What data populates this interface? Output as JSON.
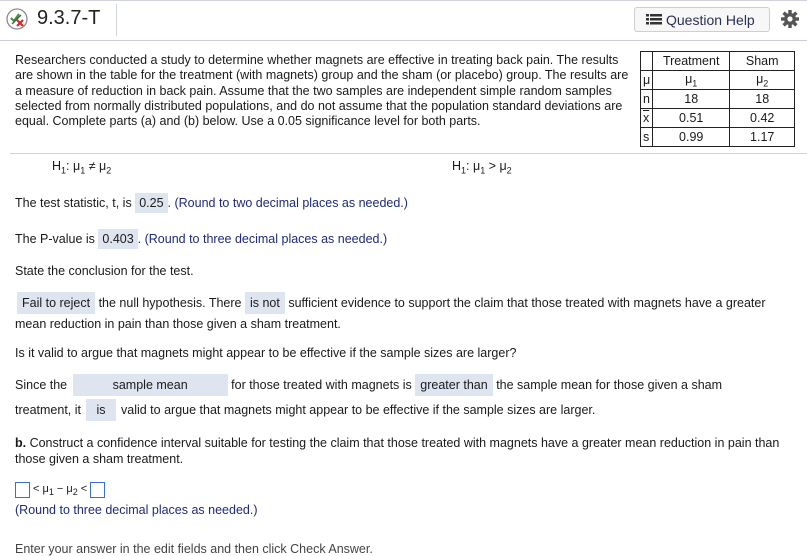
{
  "header": {
    "question_number": "9.3.7-T",
    "status_icon": "partially-correct-icon",
    "help_button_label": "Question Help",
    "help_icon": "list-icon",
    "settings_icon": "gear-icon"
  },
  "problem": {
    "text": "Researchers conducted a study to determine whether magnets are effective in treating back pain. The results are shown in the table for the treatment (with magnets) group and the sham (or placebo) group. The results are a measure of reduction in back pain. Assume that the two samples are independent simple random samples selected from normally distributed populations, and do not assume that the population standard deviations are equal. Complete parts (a) and (b) below. Use a 0.05 significance level for both parts."
  },
  "table": {
    "headers": [
      "",
      "Treatment",
      "Sham"
    ],
    "rows": [
      {
        "label": "μ",
        "treatment": "μ1",
        "sham": "μ2"
      },
      {
        "label": "n",
        "treatment": "18",
        "sham": "18"
      },
      {
        "label": "x",
        "treatment": "0.51",
        "sham": "0.42"
      },
      {
        "label": "s",
        "treatment": "0.99",
        "sham": "1.17"
      }
    ]
  },
  "hypotheses": {
    "left": {
      "h": "H",
      "sub1": "1",
      "colon": ": μ",
      "sub2": "1",
      "op": " ≠ μ",
      "sub3": "2"
    },
    "right": {
      "h": "H",
      "sub1": "1",
      "colon": ": μ",
      "sub2": "1",
      "op": " > μ",
      "sub3": "2"
    }
  },
  "test_statistic": {
    "prefix": "The test statistic, t, is",
    "value": "0.25",
    "hint": ". (Round to two decimal places as needed.)"
  },
  "p_value": {
    "prefix": "The P-value is",
    "value": "0.403",
    "hint": ". (Round to three decimal places as needed.)"
  },
  "conclusion_prompt": "State the conclusion for the test.",
  "conclusion": {
    "choice1": "Fail to reject",
    "text1": "the null hypothesis. There",
    "choice2": "is not",
    "text2": "sufficient evidence to support the claim that those treated with magnets have a greater",
    "line2": "mean reduction in pain than those given a sham treatment."
  },
  "valid_question": "Is it valid to argue that magnets might appear to be effective if the sample sizes are larger?",
  "since": {
    "prefix": "Since the",
    "choice1": "sample mean",
    "text1": "for those treated with magnets is",
    "choice2": "greater than",
    "text2": "the sample mean for those given a sham",
    "line2_prefix": "treatment, it",
    "choice3": "is",
    "text3": "valid to argue that magnets might appear to be effective if the sample sizes are larger."
  },
  "part_b": {
    "label": "b.",
    "text": " Construct a confidence interval suitable for testing the claim that those treated with magnets have a greater mean reduction in pain than those given a sham treatment.",
    "ci_lower": "",
    "ci_upper": "",
    "ci_middle": "< μ1 − μ2 <",
    "hint": "(Round to three decimal places as needed.)"
  },
  "footer_partial": "Enter your answer in the edit fields and then click Check Answer."
}
